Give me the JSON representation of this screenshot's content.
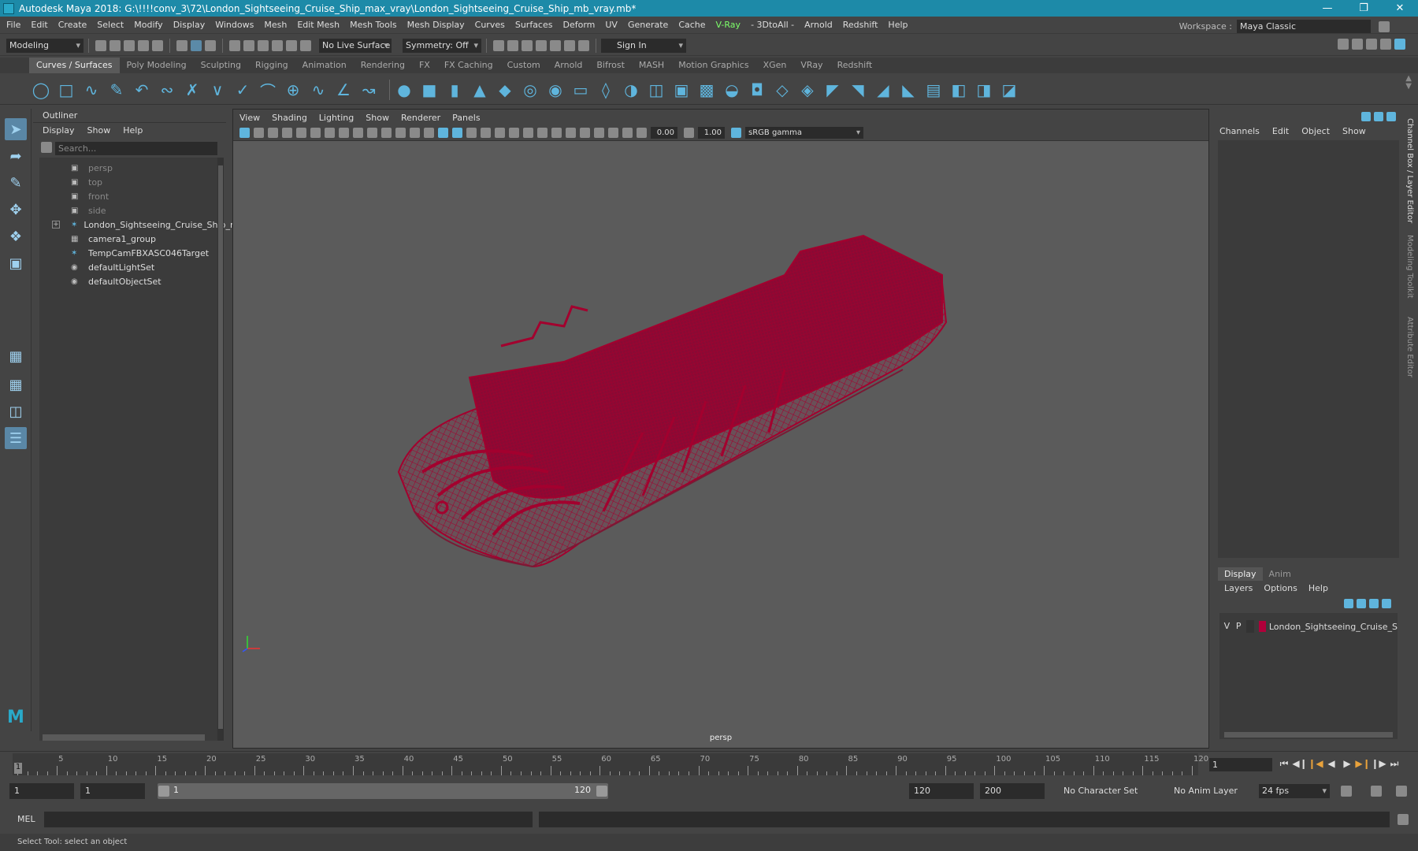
{
  "title": "Autodesk Maya 2018: G:\\!!!!conv_3\\72\\London_Sightseeing_Cruise_Ship_max_vray\\London_Sightseeing_Cruise_Ship_mb_vray.mb*",
  "menus": [
    "File",
    "Edit",
    "Create",
    "Select",
    "Modify",
    "Display",
    "Windows",
    "Mesh",
    "Edit Mesh",
    "Mesh Tools",
    "Mesh Display",
    "Curves",
    "Surfaces",
    "Deform",
    "UV",
    "Generate",
    "Cache",
    "V-Ray",
    "- 3DtoAll -",
    "Arnold",
    "Redshift",
    "Help"
  ],
  "workspace": {
    "label": "Workspace :",
    "value": "Maya Classic"
  },
  "status": {
    "mode": "Modeling",
    "live_surface": "No Live Surface",
    "symmetry": "Symmetry: Off",
    "sign_in": "Sign In"
  },
  "shelf_tabs": [
    "Curves / Surfaces",
    "Poly Modeling",
    "Sculpting",
    "Rigging",
    "Animation",
    "Rendering",
    "FX",
    "FX Caching",
    "Custom",
    "Arnold",
    "Bifrost",
    "MASH",
    "Motion Graphics",
    "XGen",
    "VRay",
    "Redshift"
  ],
  "outliner": {
    "title": "Outliner",
    "menu": [
      "Display",
      "Show",
      "Help"
    ],
    "search_placeholder": "Search...",
    "items": [
      {
        "label": "persp",
        "dim": true
      },
      {
        "label": "top",
        "dim": true
      },
      {
        "label": "front",
        "dim": true
      },
      {
        "label": "side",
        "dim": true
      },
      {
        "label": "London_Sightseeing_Cruise_Ship_ncl",
        "dim": false
      },
      {
        "label": "camera1_group",
        "dim": false
      },
      {
        "label": "TempCamFBXASC046Target",
        "dim": false
      },
      {
        "label": "defaultLightSet",
        "dim": false
      },
      {
        "label": "defaultObjectSet",
        "dim": false
      }
    ]
  },
  "viewport": {
    "menu": [
      "View",
      "Shading",
      "Lighting",
      "Show",
      "Renderer",
      "Panels"
    ],
    "exposure": "0.00",
    "gamma": "1.00",
    "colorspace": "sRGB gamma",
    "camera_label": "persp",
    "wire_color": "#a3002e"
  },
  "channel_box": {
    "menu": [
      "Channels",
      "Edit",
      "Object",
      "Show"
    ]
  },
  "layer_editor": {
    "tabs": [
      "Display",
      "Anim"
    ],
    "menu": [
      "Layers",
      "Options",
      "Help"
    ],
    "layer": {
      "v": "V",
      "p": "P",
      "name": "London_Sightseeing_Cruise_S",
      "color": "#b0003a"
    }
  },
  "side_tabs": [
    "Channel Box / Layer Editor",
    "Modeling Toolkit",
    "Attribute Editor"
  ],
  "timeline": {
    "ticks": [
      "5",
      "10",
      "15",
      "20",
      "25",
      "30",
      "35",
      "40",
      "45",
      "50",
      "55",
      "60",
      "65",
      "70",
      "75",
      "80",
      "85",
      "90",
      "95",
      "100",
      "105",
      "110",
      "115",
      "120"
    ],
    "current_frame": "1",
    "start_marker": "1"
  },
  "range": {
    "start": "1",
    "playback_start": "1",
    "slider_start": "1",
    "slider_end": "120",
    "playback_end": "120",
    "end": "200",
    "character_set": "No Character Set",
    "anim_layer": "No Anim Layer",
    "fps": "24 fps"
  },
  "mel": {
    "label": "MEL"
  },
  "status_help": "Select Tool: select an object"
}
